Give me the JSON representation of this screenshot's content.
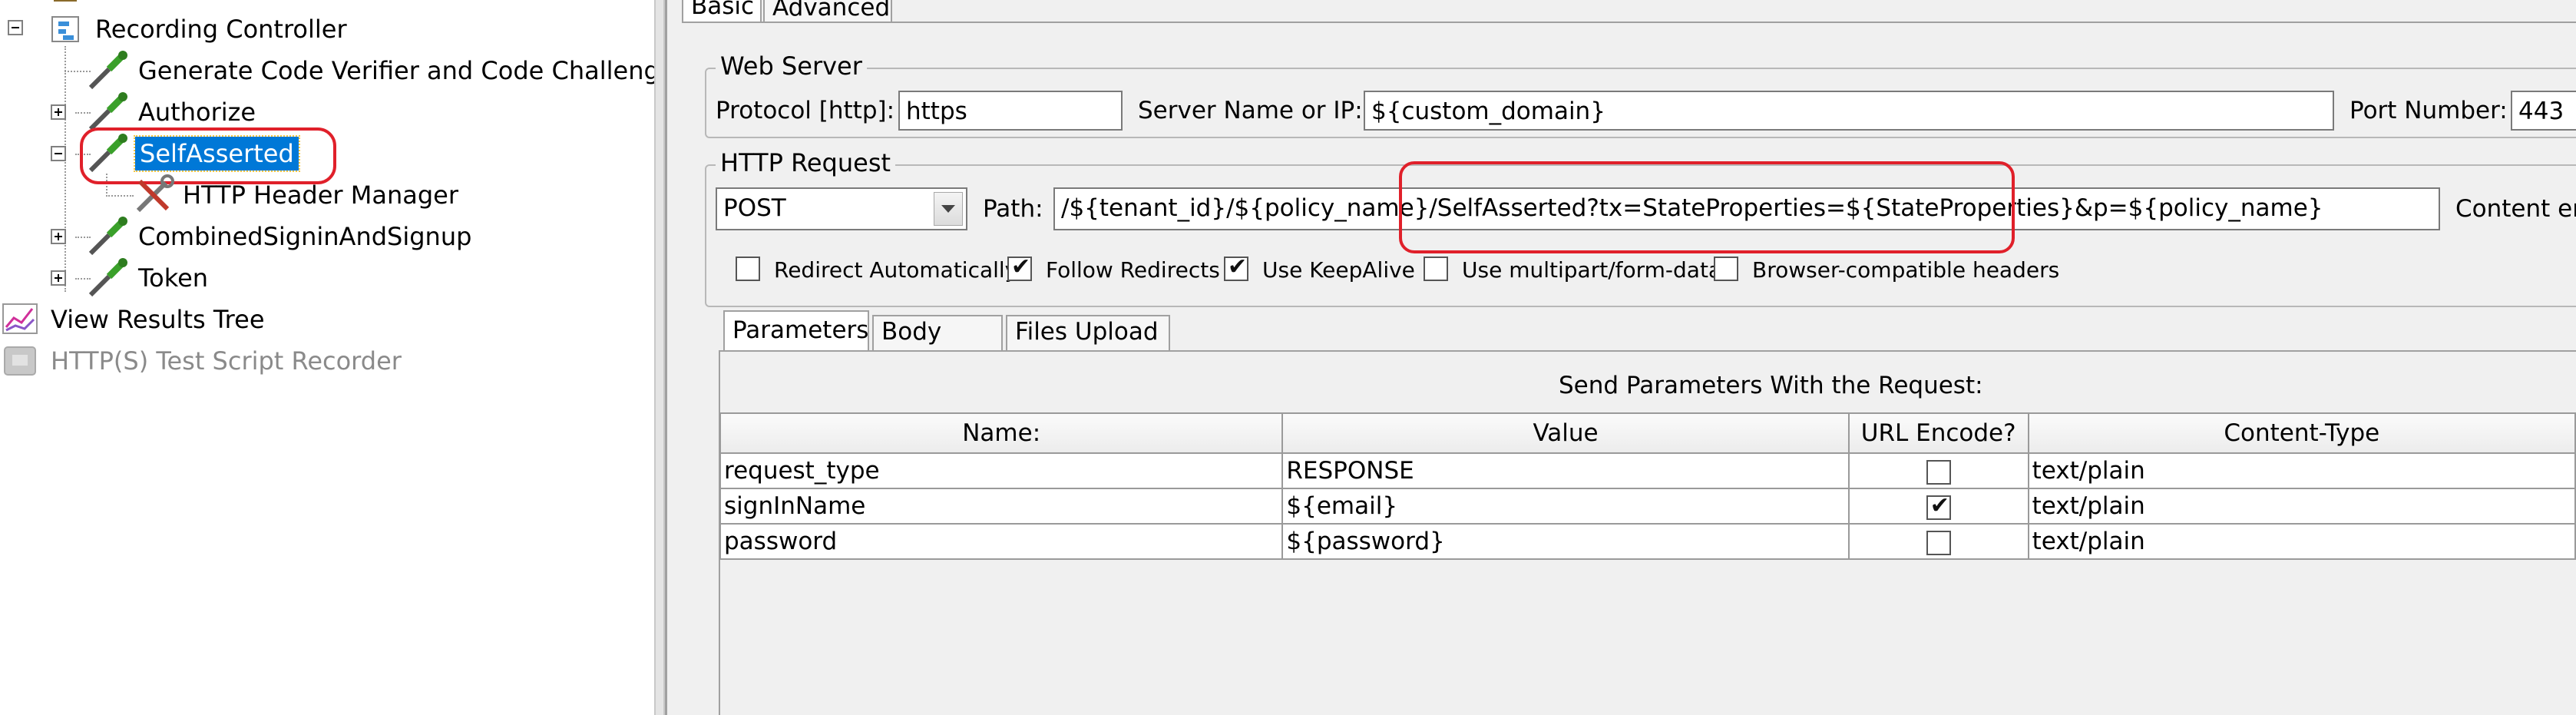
{
  "tree": {
    "items": [
      {
        "label": "Recording Controller"
      },
      {
        "label": "Generate Code Verifier and Code Challenge"
      },
      {
        "label": "Authorize"
      },
      {
        "label": "SelfAsserted"
      },
      {
        "label": "HTTP Header Manager"
      },
      {
        "label": "CombinedSigninAndSignup"
      },
      {
        "label": "Token"
      },
      {
        "label": "View Results Tree"
      },
      {
        "label": "HTTP(S) Test Script Recorder"
      }
    ]
  },
  "tabs": {
    "basic": "Basic",
    "advanced": "Advanced"
  },
  "web_server": {
    "legend": "Web Server",
    "protocol_label": "Protocol [http]:",
    "protocol_value": "https",
    "server_label": "Server Name or IP:",
    "server_value": "${custom_domain}",
    "port_label": "Port Number:",
    "port_value": "443"
  },
  "http_request": {
    "legend": "HTTP Request",
    "method": "POST",
    "path_label": "Path:",
    "path_value": "/${tenant_id}/${policy_name}/SelfAsserted?tx=StateProperties=${StateProperties}&p=${policy_name}",
    "content_label": "Content en",
    "options": [
      {
        "label": "Redirect Automatically",
        "checked": false
      },
      {
        "label": "Follow Redirects",
        "checked": true
      },
      {
        "label": "Use KeepAlive",
        "checked": true
      },
      {
        "label": "Use multipart/form-data",
        "checked": false
      },
      {
        "label": "Browser-compatible headers",
        "checked": false
      }
    ]
  },
  "sub_tabs": {
    "parameters": "Parameters",
    "body_data": "Body Data",
    "files_upload": "Files Upload"
  },
  "parameters": {
    "caption": "Send Parameters With the Request:",
    "columns": [
      "Name:",
      "Value",
      "URL Encode?",
      "Content-Type"
    ],
    "rows": [
      {
        "name": "request_type",
        "value": "RESPONSE",
        "encode": false,
        "content_type": "text/plain"
      },
      {
        "name": "signInName",
        "value": "${email}",
        "encode": true,
        "content_type": "text/plain"
      },
      {
        "name": "password",
        "value": "${password}",
        "encode": false,
        "content_type": "text/plain"
      }
    ]
  },
  "colors": {
    "selection": "#0078d7",
    "annotation": "#e0202a"
  }
}
